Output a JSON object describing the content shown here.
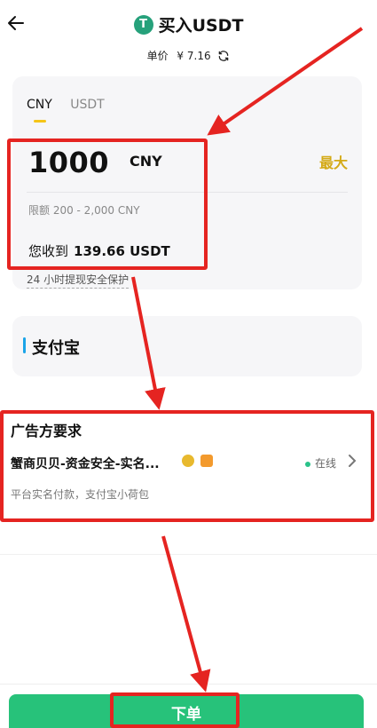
{
  "header": {
    "title": "买入USDT",
    "coin_symbol": "T",
    "back_icon": "arrow-left-icon"
  },
  "price": {
    "label": "单价",
    "value": "¥ 7.16",
    "refresh_icon": "refresh-icon"
  },
  "input_card": {
    "tabs": [
      {
        "label": "CNY",
        "active": true
      },
      {
        "label": "USDT",
        "active": false
      }
    ],
    "amount": "1000",
    "currency": "CNY",
    "max_label": "最大",
    "limit_text": "限额 200 - 2,000 CNY",
    "receive_label": "您收到",
    "receive_value": "139.66 USDT",
    "protection_text": "24 小时提现安全保护"
  },
  "payment": {
    "method": "支付宝"
  },
  "advertiser": {
    "section_title": "广告方要求",
    "merchant_name": "蟹商贝贝-资金安全-实名...",
    "status": "在线",
    "note": "平台实名付款，支付宝小荷包"
  },
  "footer": {
    "order_button": "下单"
  },
  "colors": {
    "accent_green": "#27c27a",
    "gold": "#d4aa17",
    "annotation_red": "#e52421",
    "usdt_green": "#26a17b"
  }
}
